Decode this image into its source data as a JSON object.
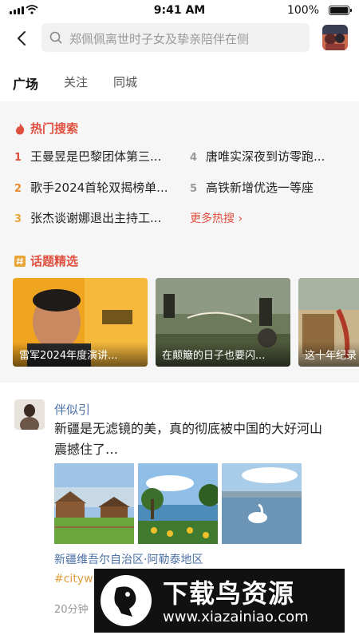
{
  "status": {
    "time": "9:41 AM",
    "battery": "100%"
  },
  "search": {
    "placeholder": "郑佩佩离世时子女及挚亲陪伴在侧"
  },
  "tabs": [
    "广场",
    "关注",
    "同城"
  ],
  "hot": {
    "title": "热门搜索",
    "items": [
      {
        "rank": "1",
        "text": "王曼昱是巴黎团体第三..."
      },
      {
        "rank": "4",
        "text": "唐唯实深夜到访零跑..."
      },
      {
        "rank": "2",
        "text": "歌手2024首轮双揭榜单..."
      },
      {
        "rank": "5",
        "text": "高铁新增优选一等座"
      },
      {
        "rank": "3",
        "text": "张杰谈谢娜退出主持工..."
      }
    ],
    "more": "更多热搜 ›"
  },
  "topics": {
    "title": "话题精选",
    "cards": [
      {
        "caption": "雷军2024年度演讲..."
      },
      {
        "caption": "在颠簸的日子也要闪..."
      },
      {
        "caption": "这十年纪录"
      }
    ]
  },
  "post": {
    "user": "伴似引",
    "text": "新疆是无滤镜的美，真的彻底被中国的大好河山震撼住了…",
    "location": "新疆维吾尔自治区·阿勒泰地区",
    "tag": "#cityw",
    "time": "20分钟"
  },
  "watermark": {
    "title": "下载鸟资源",
    "url": "www.xiazainiao.com"
  },
  "colors": {
    "accent": "#e0503f",
    "link": "#4a6fa5"
  },
  "icons": [
    "back-arrow-icon",
    "search-icon",
    "flame-icon",
    "hashtag-icon"
  ]
}
